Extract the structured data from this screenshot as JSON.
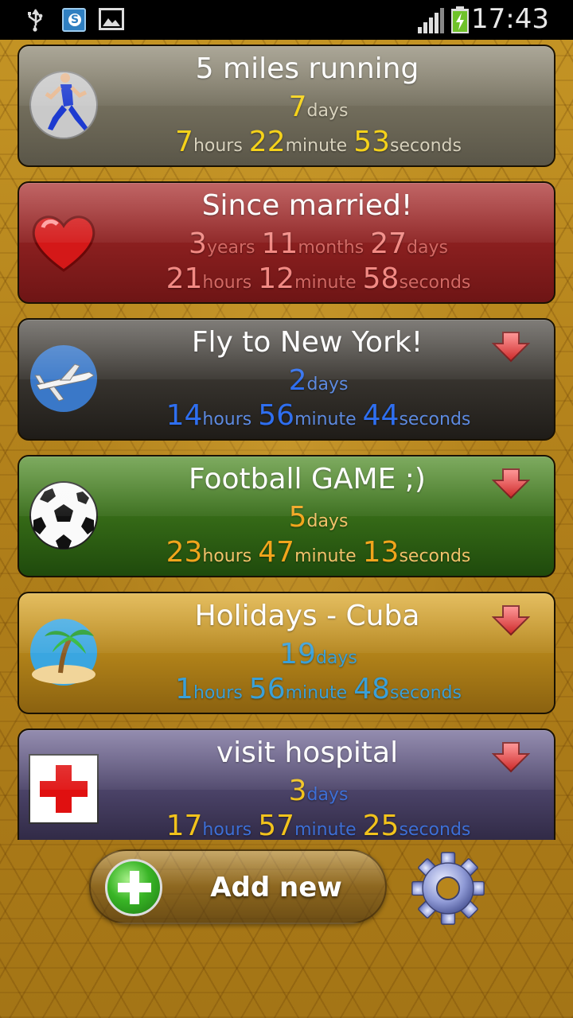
{
  "status_bar": {
    "time": "17:43",
    "icons": [
      "usb-icon",
      "skype-icon",
      "image-icon",
      "signal-icon",
      "battery-charging-icon"
    ]
  },
  "events": [
    {
      "title": "5 miles running",
      "icon": "runner-icon",
      "theme": {
        "bg_top": "#8b8570",
        "bg_bottom": "#5a5648",
        "number_color": "#f5d21a",
        "unit_color": "#d8d2bd"
      },
      "has_alert_arrow": false,
      "line1": [
        {
          "n": "7",
          "u": "days"
        }
      ],
      "line2": [
        {
          "n": "7",
          "u": "hours"
        },
        {
          "n": "22",
          "u": "minute"
        },
        {
          "n": "53",
          "u": "seconds"
        }
      ]
    },
    {
      "title": "Since married!",
      "icon": "heart-icon",
      "theme": {
        "bg_top": "#a82a2a",
        "bg_bottom": "#6e1515",
        "number_color": "#f28a84",
        "unit_color": "#d26964"
      },
      "has_alert_arrow": false,
      "line1": [
        {
          "n": "3",
          "u": "years"
        },
        {
          "n": "11",
          "u": "months"
        },
        {
          "n": "27",
          "u": "days"
        }
      ],
      "line2": [
        {
          "n": "21",
          "u": "hours"
        },
        {
          "n": "12",
          "u": "minute"
        },
        {
          "n": "58",
          "u": "seconds"
        }
      ]
    },
    {
      "title": "Fly to New York!",
      "icon": "airplane-icon",
      "theme": {
        "bg_top": "#4e4a44",
        "bg_bottom": "#1f1c18",
        "number_color": "#2f6ff0",
        "unit_color": "#5d8ae0"
      },
      "has_alert_arrow": true,
      "line1": [
        {
          "n": "2",
          "u": "days"
        }
      ],
      "line2": [
        {
          "n": "14",
          "u": "hours"
        },
        {
          "n": "56",
          "u": "minute"
        },
        {
          "n": "44",
          "u": "seconds"
        }
      ]
    },
    {
      "title": "Football GAME ;)",
      "icon": "soccer-ball-icon",
      "theme": {
        "bg_top": "#4c8a22",
        "bg_bottom": "#1f4a0c",
        "number_color": "#f2a51c",
        "unit_color": "#f2c26a"
      },
      "has_alert_arrow": true,
      "line1": [
        {
          "n": "5",
          "u": "days"
        }
      ],
      "line2": [
        {
          "n": "23",
          "u": "hours"
        },
        {
          "n": "47",
          "u": "minute"
        },
        {
          "n": "13",
          "u": "seconds"
        }
      ]
    },
    {
      "title": "Holidays - Cuba",
      "icon": "palm-island-icon",
      "theme": {
        "bg_top": "#d9a423",
        "bg_bottom": "#8b6210",
        "number_color": "#3aa0d8",
        "unit_color": "#3a9fd6"
      },
      "has_alert_arrow": true,
      "line1": [
        {
          "n": "19",
          "u": "days"
        }
      ],
      "line2": [
        {
          "n": "1",
          "u": "hours"
        },
        {
          "n": "56",
          "u": "minute"
        },
        {
          "n": "48",
          "u": "seconds"
        }
      ]
    },
    {
      "title": "visit hospital",
      "icon": "red-cross-icon",
      "theme": {
        "bg_top": "#6a6090",
        "bg_bottom": "#2c2640",
        "number_color": "#f2c31c",
        "unit_color": "#3d6fd6"
      },
      "has_alert_arrow": true,
      "line1": [
        {
          "n": "3",
          "u": "days"
        }
      ],
      "line2": [
        {
          "n": "17",
          "u": "hours"
        },
        {
          "n": "57",
          "u": "minute"
        },
        {
          "n": "25",
          "u": "seconds"
        }
      ]
    }
  ],
  "bottom_bar": {
    "add_label": "Add new",
    "add_icon": "plus-icon",
    "settings_icon": "gear-icon"
  }
}
